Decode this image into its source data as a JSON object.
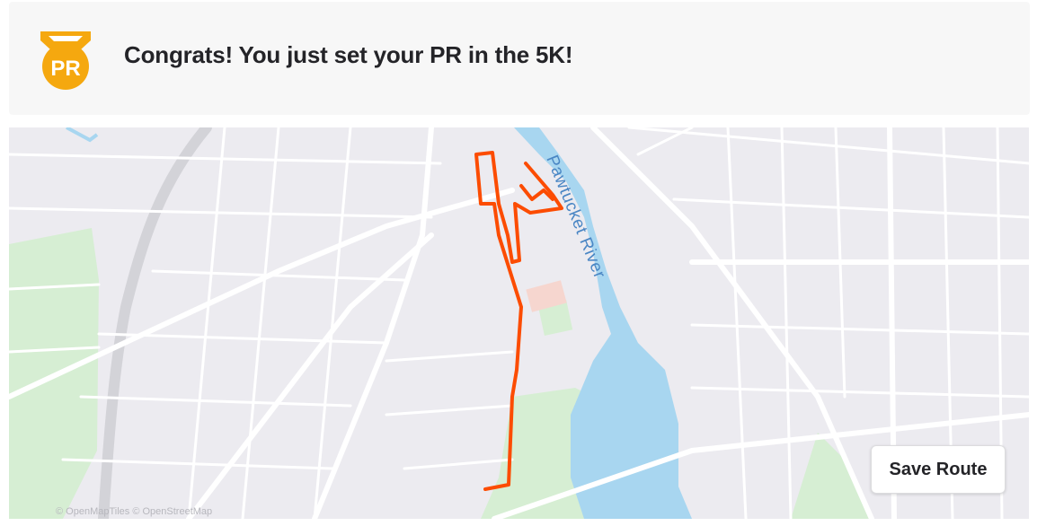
{
  "banner": {
    "badge_text": "PR",
    "message": "Congrats! You just set your PR in the 5K!"
  },
  "map": {
    "river_label": "Pawtucket River",
    "attribution": "© OpenMapTiles © OpenStreetMap",
    "save_button_label": "Save Route"
  },
  "colors": {
    "badge": "#f5a80f",
    "route": "#fc4c02",
    "water": "#a8d6f0",
    "park": "#d6eed3",
    "map_background": "#ecebf0"
  }
}
